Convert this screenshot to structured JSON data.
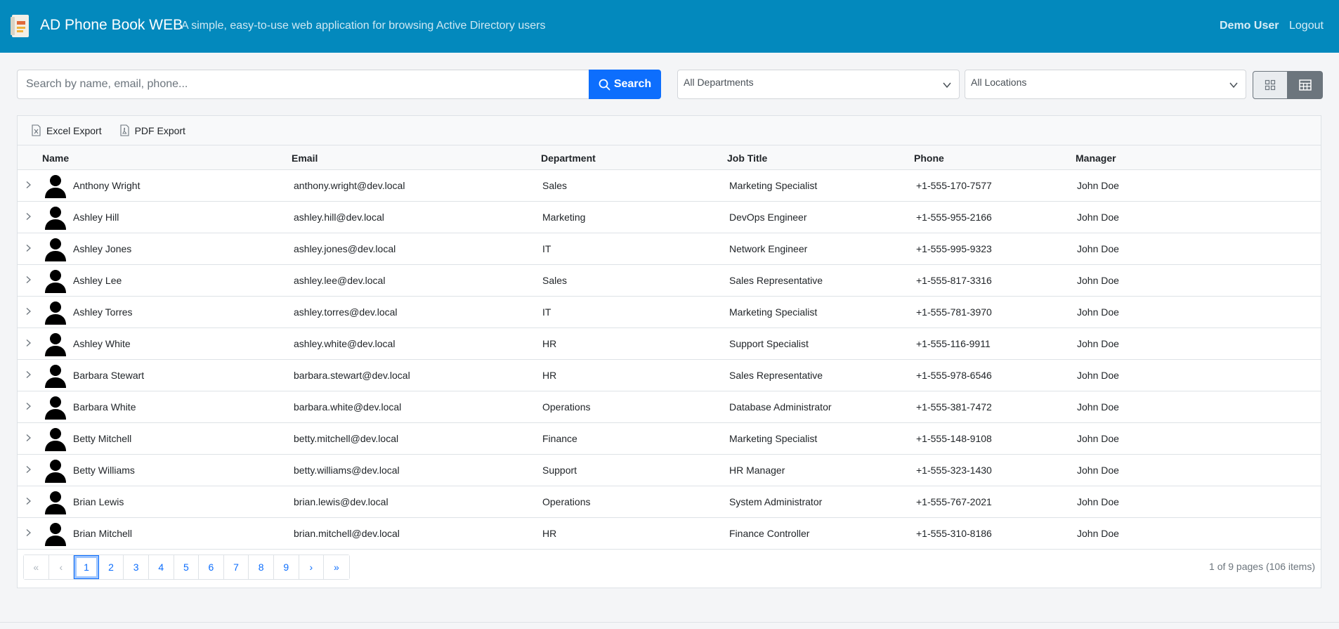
{
  "header": {
    "title": "AD Phone Book WEB",
    "subtitle": "A simple, easy-to-use web application for browsing Active Directory users",
    "user": "Demo User",
    "logout": "Logout"
  },
  "search": {
    "placeholder": "Search by name, email, phone...",
    "button": "Search"
  },
  "filters": {
    "department": "All Departments",
    "location": "All Locations"
  },
  "toolbar": {
    "excel": "Excel Export",
    "pdf": "PDF Export"
  },
  "columns": [
    "Name",
    "Email",
    "Department",
    "Job Title",
    "Phone",
    "Manager"
  ],
  "rows": [
    {
      "name": "Anthony Wright",
      "email": "anthony.wright@dev.local",
      "department": "Sales",
      "title": "Marketing Specialist",
      "phone": "+1-555-170-7577",
      "manager": "John Doe"
    },
    {
      "name": "Ashley Hill",
      "email": "ashley.hill@dev.local",
      "department": "Marketing",
      "title": "DevOps Engineer",
      "phone": "+1-555-955-2166",
      "manager": "John Doe"
    },
    {
      "name": "Ashley Jones",
      "email": "ashley.jones@dev.local",
      "department": "IT",
      "title": "Network Engineer",
      "phone": "+1-555-995-9323",
      "manager": "John Doe"
    },
    {
      "name": "Ashley Lee",
      "email": "ashley.lee@dev.local",
      "department": "Sales",
      "title": "Sales Representative",
      "phone": "+1-555-817-3316",
      "manager": "John Doe"
    },
    {
      "name": "Ashley Torres",
      "email": "ashley.torres@dev.local",
      "department": "IT",
      "title": "Marketing Specialist",
      "phone": "+1-555-781-3970",
      "manager": "John Doe"
    },
    {
      "name": "Ashley White",
      "email": "ashley.white@dev.local",
      "department": "HR",
      "title": "Support Specialist",
      "phone": "+1-555-116-9911",
      "manager": "John Doe"
    },
    {
      "name": "Barbara Stewart",
      "email": "barbara.stewart@dev.local",
      "department": "HR",
      "title": "Sales Representative",
      "phone": "+1-555-978-6546",
      "manager": "John Doe"
    },
    {
      "name": "Barbara White",
      "email": "barbara.white@dev.local",
      "department": "Operations",
      "title": "Database Administrator",
      "phone": "+1-555-381-7472",
      "manager": "John Doe"
    },
    {
      "name": "Betty Mitchell",
      "email": "betty.mitchell@dev.local",
      "department": "Finance",
      "title": "Marketing Specialist",
      "phone": "+1-555-148-9108",
      "manager": "John Doe"
    },
    {
      "name": "Betty Williams",
      "email": "betty.williams@dev.local",
      "department": "Support",
      "title": "HR Manager",
      "phone": "+1-555-323-1430",
      "manager": "John Doe"
    },
    {
      "name": "Brian Lewis",
      "email": "brian.lewis@dev.local",
      "department": "Operations",
      "title": "System Administrator",
      "phone": "+1-555-767-2021",
      "manager": "John Doe"
    },
    {
      "name": "Brian Mitchell",
      "email": "brian.mitchell@dev.local",
      "department": "HR",
      "title": "Finance Controller",
      "phone": "+1-555-310-8186",
      "manager": "John Doe"
    }
  ],
  "pager": {
    "first": "«",
    "prev": "‹",
    "pages": [
      "1",
      "2",
      "3",
      "4",
      "5",
      "6",
      "7",
      "8",
      "9"
    ],
    "next": "›",
    "last": "»",
    "info": "1 of 9 pages (106 items)"
  },
  "icons": {
    "logo": "phone-book-icon",
    "search": "search-icon",
    "chevron": "chevron-down-icon",
    "grid_view": "grid-view-icon",
    "table_view": "table-view-icon",
    "excel": "excel-file-icon",
    "pdf": "pdf-file-icon",
    "expand": "chevron-right-icon",
    "avatar": "person-icon"
  },
  "colors": {
    "header": "#0389bd",
    "primary": "#0d6efd",
    "active_toggle": "#6c757d"
  }
}
